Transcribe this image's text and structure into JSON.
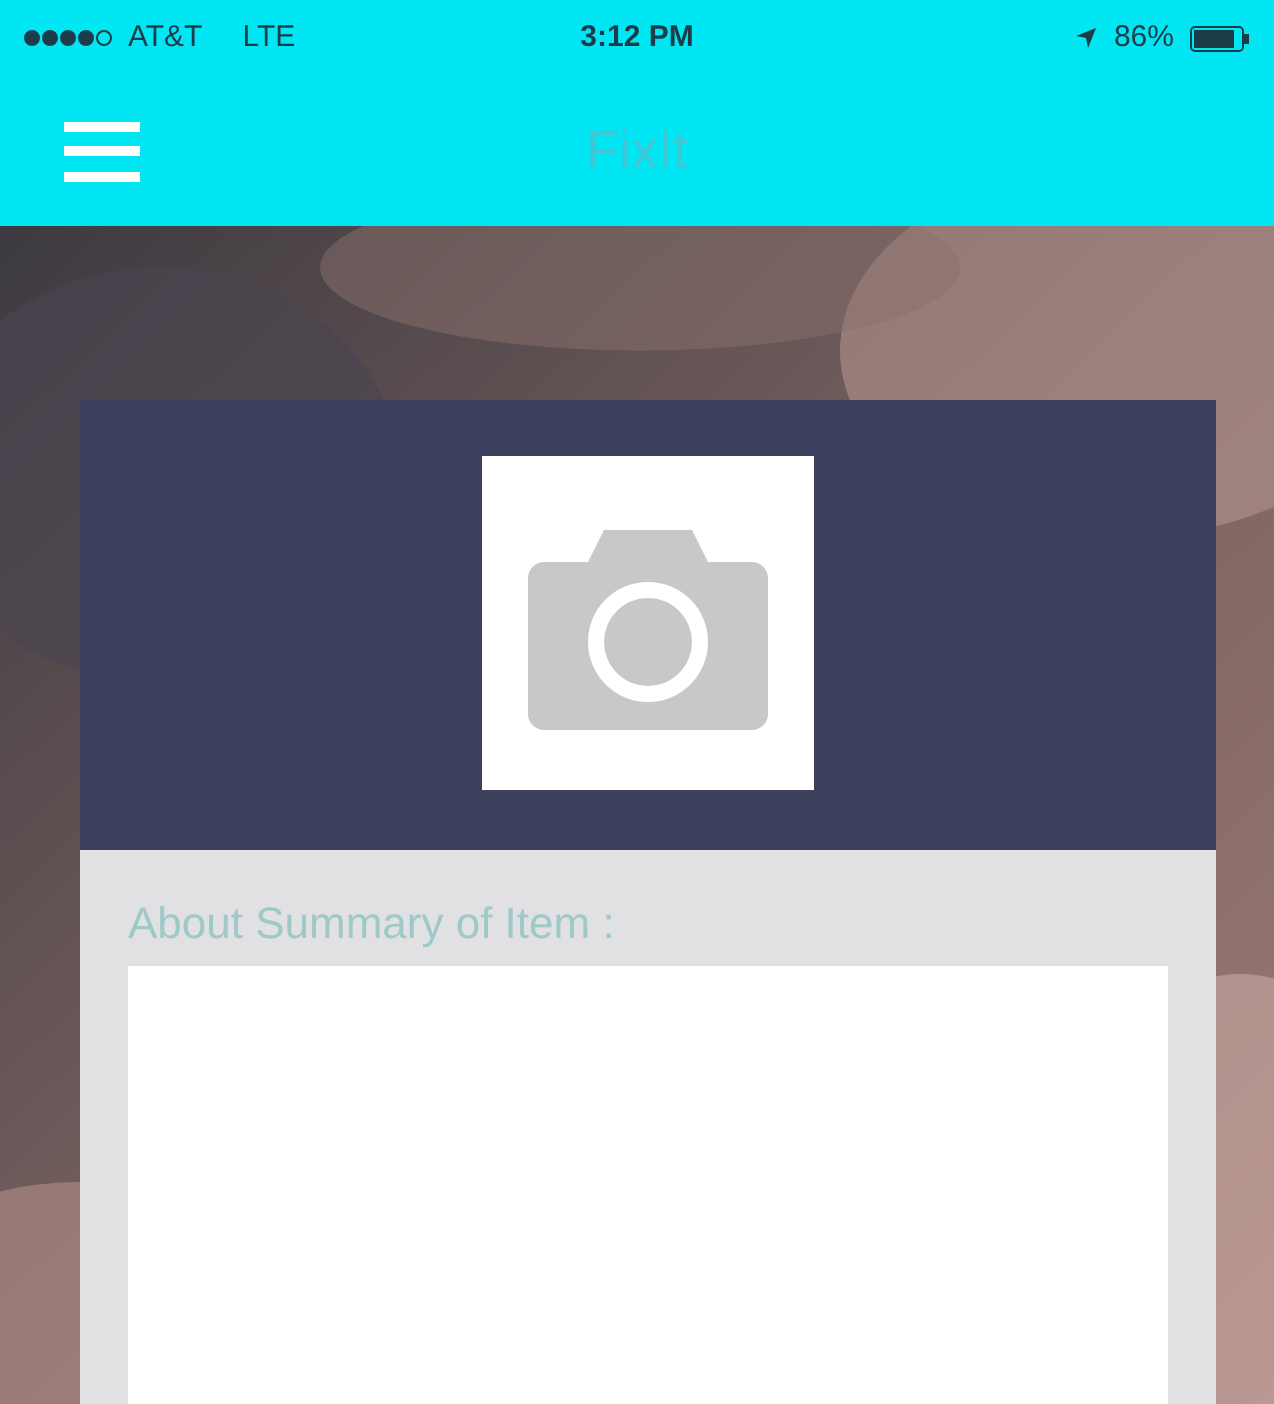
{
  "status_bar": {
    "carrier": "AT&T",
    "network": "LTE",
    "time": "3:12 PM",
    "battery": "86%"
  },
  "nav_bar": {
    "title": "FixIt"
  },
  "form": {
    "summary_label": "About Summary of Item :"
  }
}
